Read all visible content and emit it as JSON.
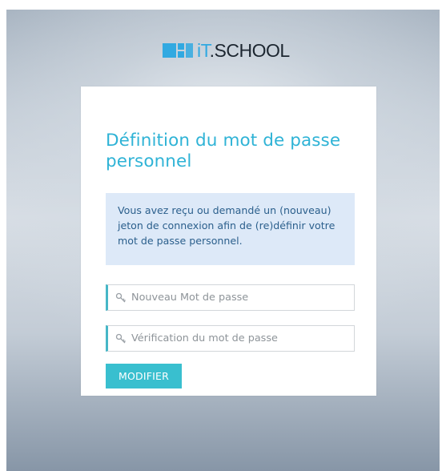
{
  "brand": {
    "logo_text_accent": "iT",
    "logo_text_rest": ".SCHOOL",
    "accent_color": "#31a9e1"
  },
  "form": {
    "title": "Définition du mot de passe personnel",
    "info_message": "Vous avez reçu ou demandé un (nouveau) jeton de connexion afin de (re)définir votre mot de passe personnel.",
    "new_password": {
      "placeholder": "Nouveau Mot de passe",
      "value": "",
      "icon": "key-icon"
    },
    "verify_password": {
      "placeholder": "Vérification du mot de passe",
      "value": "",
      "icon": "key-icon"
    },
    "submit_label": "MODIFIER",
    "title_color": "#2fb3d6",
    "button_color": "#39bfcf",
    "info_background": "#dde9f8"
  }
}
